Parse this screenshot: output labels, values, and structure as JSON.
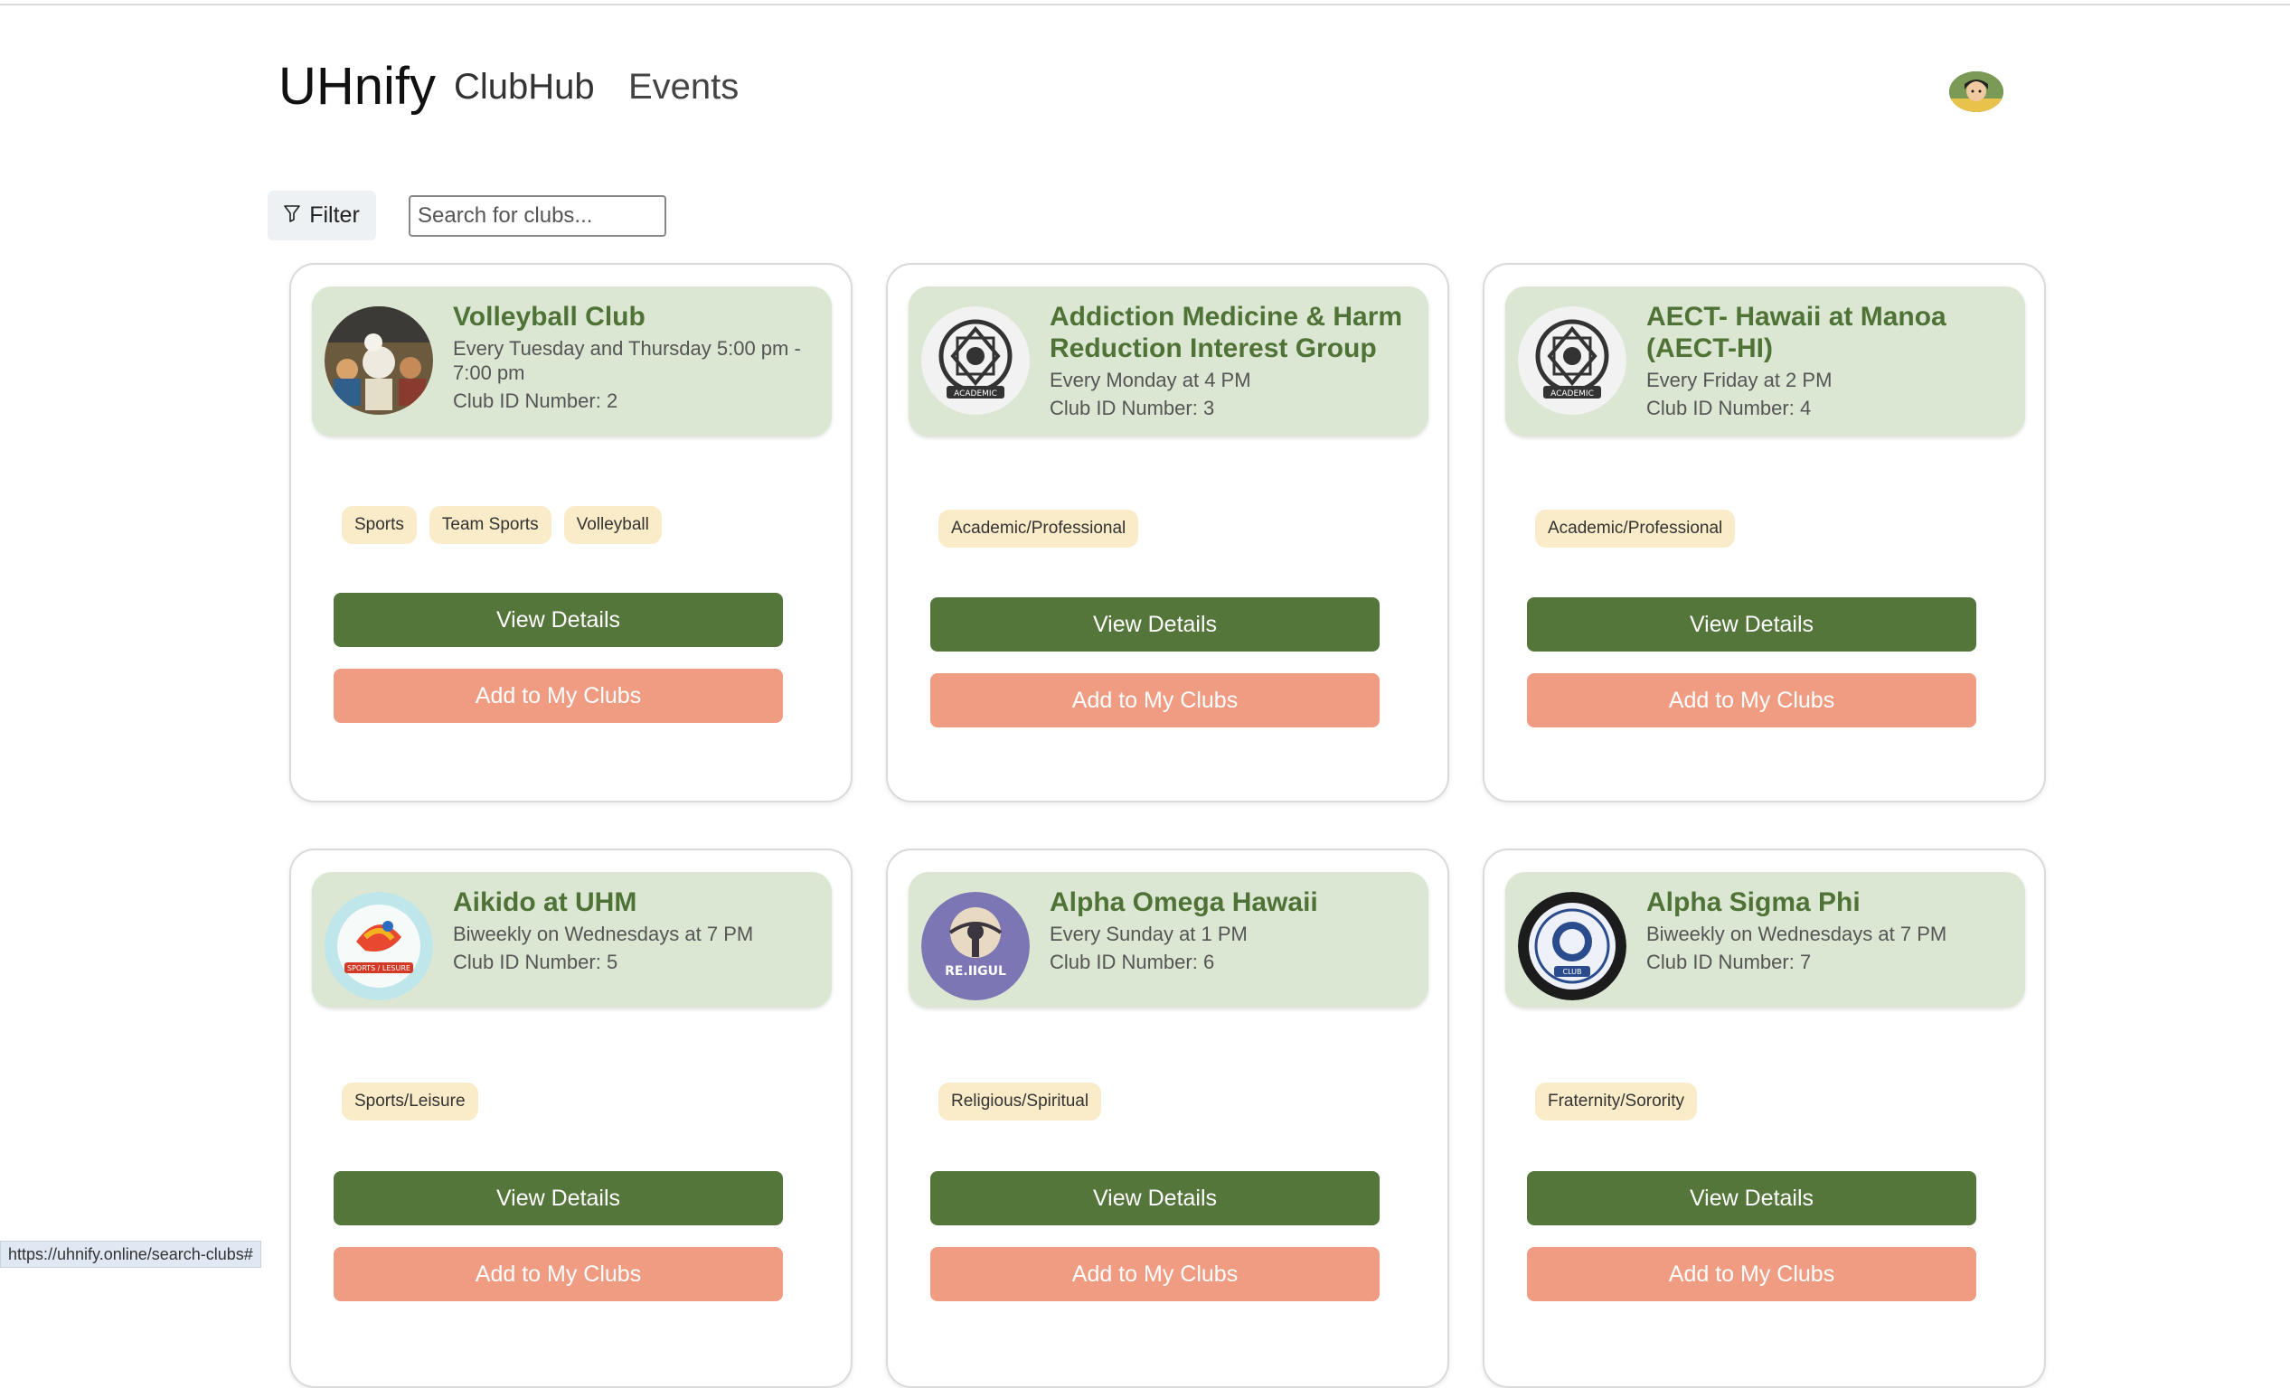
{
  "header": {
    "brand": "UHnify",
    "nav": [
      {
        "label": "ClubHub"
      },
      {
        "label": "Events"
      }
    ]
  },
  "toolbar": {
    "filter_label": "Filter",
    "search_placeholder": "Search for clubs..."
  },
  "clubs": [
    {
      "name": "Volleyball Club",
      "schedule": "Every Tuesday and Thursday 5:00 pm - 7:00 pm",
      "id_text": "Club ID Number: 2",
      "tags": [
        "Sports",
        "Team Sports",
        "Volleyball"
      ],
      "view_label": "View Details",
      "add_label": "Add to My Clubs",
      "logo": "volleyball-club-logo"
    },
    {
      "name": "Addiction Medicine & Harm Reduction Interest Group",
      "schedule": "Every Monday at 4 PM",
      "id_text": "Club ID Number: 3",
      "tags": [
        "Academic/Professional"
      ],
      "view_label": "View Details",
      "add_label": "Add to My Clubs",
      "logo": "academic-badge-logo"
    },
    {
      "name": "AECT- Hawaii at Manoa (AECT-HI)",
      "schedule": "Every Friday at 2 PM",
      "id_text": "Club ID Number: 4",
      "tags": [
        "Academic/Professional"
      ],
      "view_label": "View Details",
      "add_label": "Add to My Clubs",
      "logo": "academic-badge-logo"
    },
    {
      "name": "Aikido at UHM",
      "schedule": "Biweekly on Wednesdays at 7 PM",
      "id_text": "Club ID Number: 5",
      "tags": [
        "Sports/Leisure"
      ],
      "view_label": "View Details",
      "add_label": "Add to My Clubs",
      "logo": "sports-leisure-logo"
    },
    {
      "name": "Alpha Omega Hawaii",
      "schedule": "Every Sunday at 1 PM",
      "id_text": "Club ID Number: 6",
      "tags": [
        "Religious/Spiritual"
      ],
      "view_label": "View Details",
      "add_label": "Add to My Clubs",
      "logo": "religious-logo"
    },
    {
      "name": "Alpha Sigma Phi",
      "schedule": "Biweekly on Wednesdays at 7 PM",
      "id_text": "Club ID Number: 7",
      "tags": [
        "Fraternity/Sorority"
      ],
      "view_label": "View Details",
      "add_label": "Add to My Clubs",
      "logo": "fraternity-sorority-logo"
    }
  ],
  "status_url": "https://uhnify.online/search-clubs#",
  "colors": {
    "brand_green": "#4f7337",
    "button_green": "#55763a",
    "button_salmon": "#f09c82",
    "header_bg": "#dce7d3",
    "tag_bg": "#fbecc9"
  }
}
